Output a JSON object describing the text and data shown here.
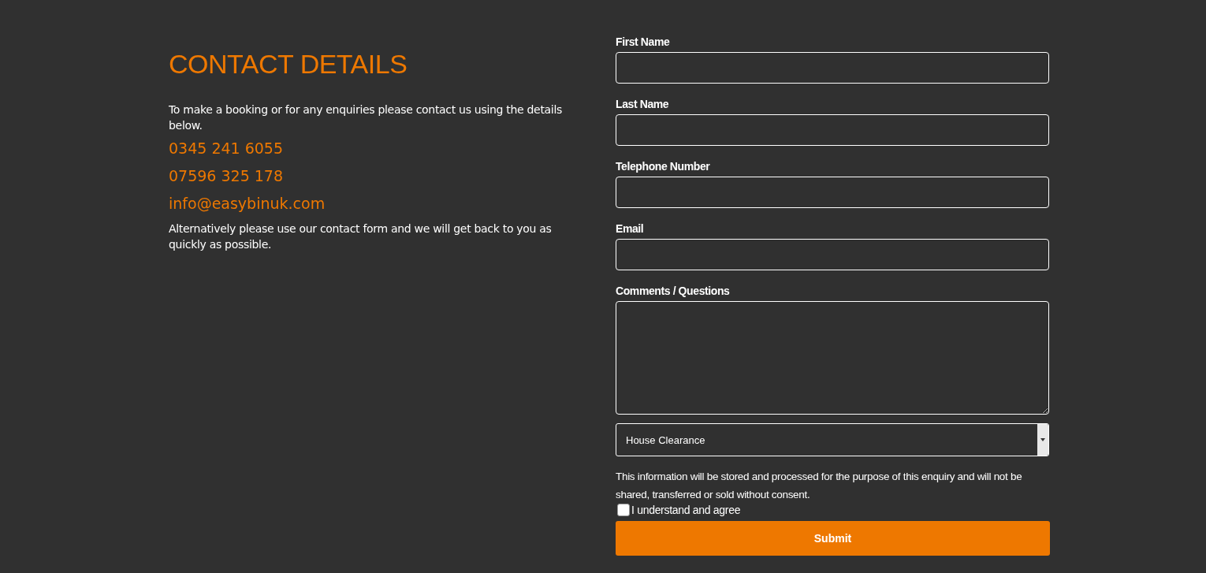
{
  "heading": "CONTACT DETAILS",
  "intro": "To make a booking or for any enquiries please contact us using the details below.",
  "contacts": [
    "0345 241 6055",
    "07596 325 178",
    "info@easybinuk.com"
  ],
  "outro": "Alternatively please use our contact form and we will get back to you as quickly as possible.",
  "form": {
    "fields": [
      {
        "label": "First Name",
        "kind": "text"
      },
      {
        "label": "Last Name",
        "kind": "text"
      },
      {
        "label": "Telephone Number",
        "kind": "text"
      },
      {
        "label": "Email",
        "kind": "text"
      },
      {
        "label": "Comments / Questions",
        "kind": "textarea"
      }
    ],
    "select": {
      "value": "House Clearance"
    },
    "notice": "This information will be stored and processed for the purpose of this enquiry and will not be shared, transferred or sold without consent.",
    "consent": {
      "label": "I understand and agree",
      "checked": false
    },
    "submit": "Submit"
  }
}
